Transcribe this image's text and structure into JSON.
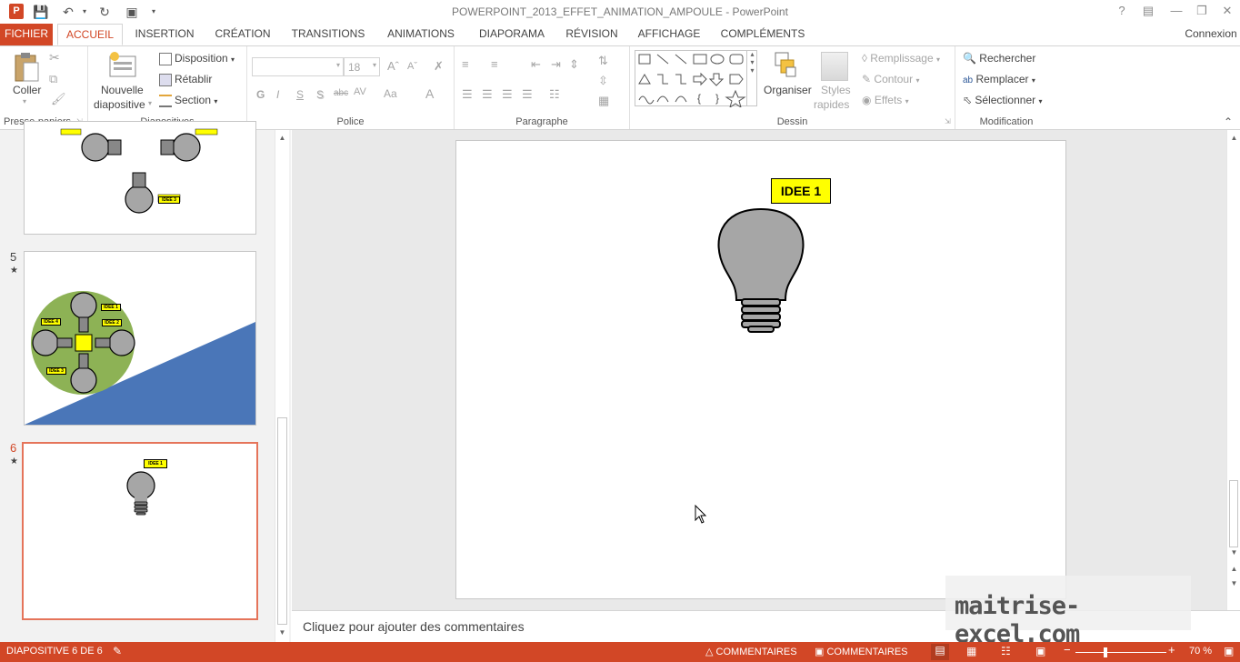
{
  "window": {
    "title": "POWERPOINT_2013_EFFET_ANIMATION_AMPOULE - PowerPoint",
    "app_icon": "P",
    "help": "?",
    "signin": "Connexion"
  },
  "tabs": [
    "FICHIER",
    "ACCUEIL",
    "INSERTION",
    "CRÉATION",
    "TRANSITIONS",
    "ANIMATIONS",
    "DIAPORAMA",
    "RÉVISION",
    "AFFICHAGE",
    "COMPLÉMENTS"
  ],
  "active_tab": "ACCUEIL",
  "ribbon": {
    "clipboard": {
      "label": "Presse-papiers",
      "paste": "Coller"
    },
    "slides": {
      "label": "Diapositives",
      "new1": "Nouvelle",
      "new2": "diapositive",
      "layout": "Disposition",
      "reset": "Rétablir",
      "section": "Section"
    },
    "font": {
      "label": "Police",
      "font_name": "",
      "font_size": "18",
      "bold": "G",
      "italic": "I",
      "underline": "S",
      "shadow": "S",
      "strike": "abc",
      "spacing": "AV",
      "case": "Aa",
      "color": "A"
    },
    "paragraph": {
      "label": "Paragraphe"
    },
    "drawing": {
      "label": "Dessin",
      "arrange": "Organiser",
      "styles1": "Styles",
      "styles2": "rapides",
      "fill": "Remplissage",
      "outline": "Contour",
      "effects": "Effets"
    },
    "editing": {
      "label": "Modification",
      "find": "Rechercher",
      "replace": "Remplacer",
      "select": "Sélectionner"
    }
  },
  "slides_panel": {
    "slides": [
      {
        "number": "5",
        "star": "★"
      },
      {
        "number": "6",
        "star": "★"
      }
    ],
    "thumb4_label": "IDEE 3",
    "thumb5_labels": [
      "IDEE 1",
      "IDEE 4",
      "IDEE 2",
      "IDEE 3"
    ],
    "thumb6_label": "IDEE 1"
  },
  "slide": {
    "label": "IDEE 1"
  },
  "notes_placeholder": "Cliquez pour ajouter des commentaires",
  "status": {
    "slide_info": "DIAPOSITIVE 6 DE 6",
    "notes": "COMMENTAIRES",
    "comments": "COMMENTAIRES",
    "zoom": "70 %"
  },
  "watermark": "maitrise-excel.com",
  "colors": {
    "accent": "#d24726",
    "bulb": "#a6a6a6",
    "label": "#ffff00",
    "green": "#8db255",
    "blue": "#4a76b8"
  }
}
